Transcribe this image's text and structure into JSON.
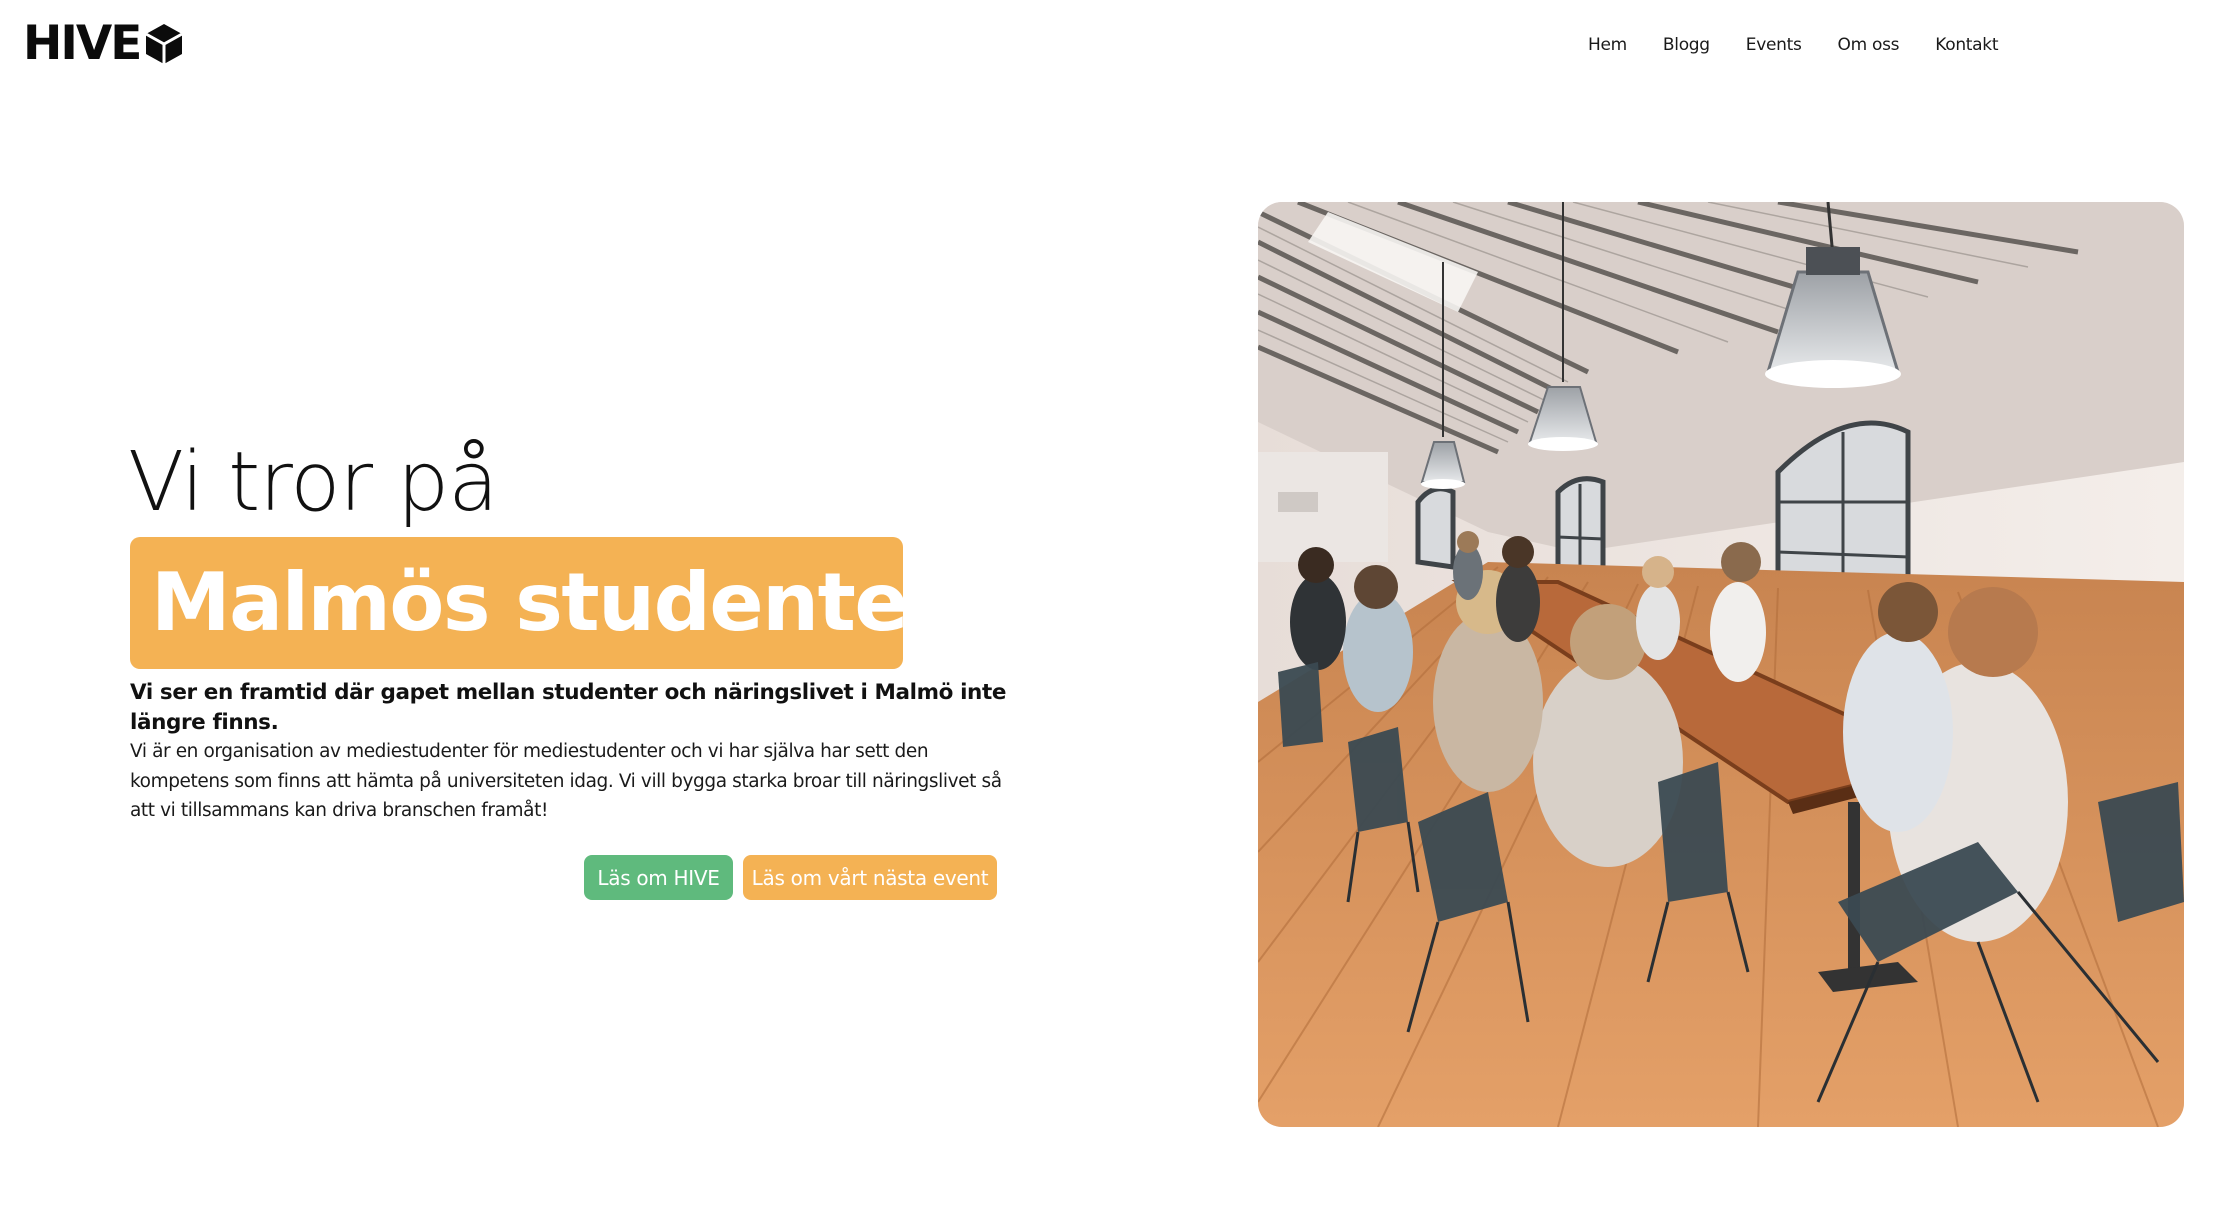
{
  "header": {
    "logo_text": "HIVE",
    "logo_icon": "hexagon-cube-icon",
    "nav": [
      {
        "label": "Hem"
      },
      {
        "label": "Blogg"
      },
      {
        "label": "Events"
      },
      {
        "label": "Om oss"
      },
      {
        "label": "Kontakt"
      }
    ]
  },
  "hero": {
    "pre_heading": "Vi tror på",
    "highlight": "Malmös studenter",
    "lead": "Vi ser en framtid där gapet mellan studenter och näringslivet i Malmö inte längre finns.",
    "body": "Vi är en organisation av mediestudenter för mediestudenter och vi har själva har sett den kompetens som finns att hämta på universiteten idag. Vi vill bygga starka broar till näringslivet så att vi tillsammans kan driva branschen framåt!",
    "buttons": {
      "about": "Läs om HIVE",
      "event": "Läs om vårt nästa event"
    }
  },
  "image": {
    "description_icon": "conference-room-photo"
  },
  "colors": {
    "accent_orange": "#f4b254",
    "accent_green": "#5fba7d",
    "text": "#111111",
    "background": "#ffffff"
  }
}
